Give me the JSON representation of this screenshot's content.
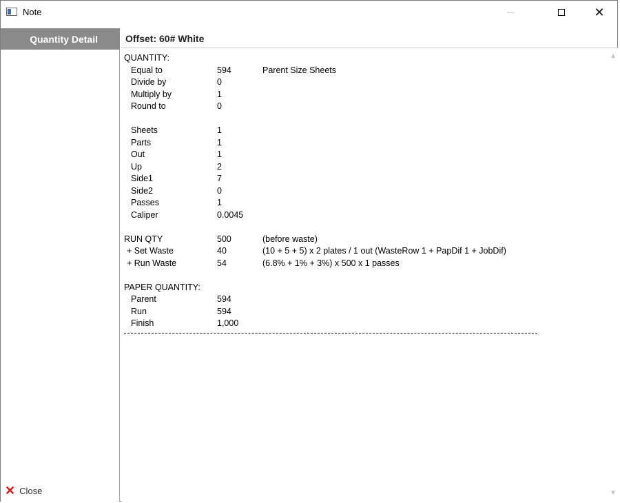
{
  "window": {
    "title": "Note"
  },
  "sidebar": {
    "header": "Quantity Detail",
    "close_label": "Close"
  },
  "content": {
    "title": "Offset: 60# White",
    "quantity_heading": "QUANTITY:",
    "quantity_rows": [
      {
        "label": "Equal to",
        "value": "594",
        "note": "Parent Size Sheets"
      },
      {
        "label": "Divide by",
        "value": "0",
        "note": ""
      },
      {
        "label": "Multiply by",
        "value": "1",
        "note": ""
      },
      {
        "label": "Round to",
        "value": "0",
        "note": ""
      }
    ],
    "spec_rows": [
      {
        "label": "Sheets",
        "value": "1"
      },
      {
        "label": "Parts",
        "value": "1"
      },
      {
        "label": "Out",
        "value": "1"
      },
      {
        "label": "Up",
        "value": "2"
      },
      {
        "label": "Side1",
        "value": "7"
      },
      {
        "label": "Side2",
        "value": "0"
      },
      {
        "label": "Passes",
        "value": "1"
      },
      {
        "label": "Caliper",
        "value": "0.0045"
      }
    ],
    "run_rows": [
      {
        "label": "RUN QTY",
        "value": "500",
        "note": "(before waste)"
      },
      {
        "label": "+ Set Waste",
        "value": "40",
        "note": "(10 + 5 + 5) x 2 plates / 1 out   (WasteRow 1 + PapDif 1 + JobDif)"
      },
      {
        "label": "+ Run Waste",
        "value": "54",
        "note": "(6.8% + 1% + 3%) x 500 x 1 passes"
      }
    ],
    "paper_heading": "PAPER QUANTITY:",
    "paper_rows": [
      {
        "label": "Parent",
        "value": "594"
      },
      {
        "label": "Run",
        "value": "594"
      },
      {
        "label": "Finish",
        "value": "1,000"
      }
    ]
  },
  "colors": {
    "sidebar_header_bg": "#8a8a8a",
    "close_icon": "#d41c1c"
  },
  "icons": {
    "app": "window-icon",
    "minimize": "minimize-icon",
    "maximize": "maximize-icon",
    "close": "close-icon",
    "sidebar_close": "red-x-icon"
  }
}
